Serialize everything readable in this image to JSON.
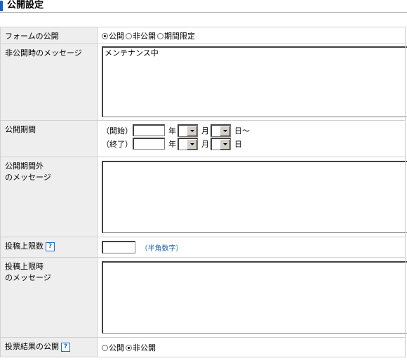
{
  "page": {
    "title": "公開設定"
  },
  "rows": {
    "form_public": {
      "label": "フォームの公開",
      "options": [
        "公開",
        "非公開",
        "期間限定"
      ],
      "selected": "公開"
    },
    "private_message": {
      "label": "非公開時のメッセージ",
      "value": "メンテナンス中"
    },
    "period": {
      "label": "公開期間",
      "start_label": "（開始）",
      "end_label": "（終了）",
      "year_unit": "年",
      "month_unit": "月",
      "start_day_unit": "日～",
      "end_day_unit": "日"
    },
    "out_of_period_message": {
      "label_line1": "公開期間外",
      "label_line2": "のメッセージ",
      "value": ""
    },
    "post_limit": {
      "label": "投稿上限数",
      "help": "?",
      "value": "",
      "hint": "（半角数字）"
    },
    "limit_message": {
      "label_line1": "投稿上限時",
      "label_line2": "のメッセージ",
      "value": ""
    },
    "results_public": {
      "label": "投票結果の公開",
      "help": "?",
      "options": [
        "公開",
        "非公開"
      ],
      "selected": "非公開"
    }
  }
}
